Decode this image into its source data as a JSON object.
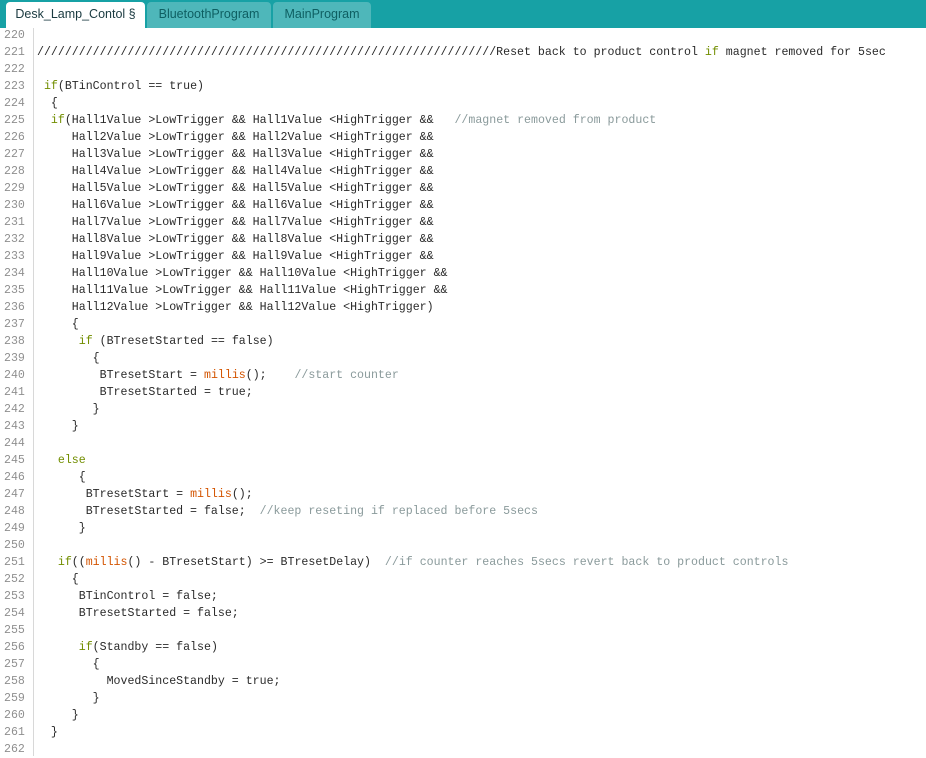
{
  "tabs": [
    {
      "label": "Desk_Lamp_Contol §",
      "active": true
    },
    {
      "label": "BluetoothProgram",
      "active": false
    },
    {
      "label": "MainProgram",
      "active": false
    }
  ],
  "colors": {
    "tabbar": "#17a1a5",
    "keyword": "#728e00",
    "function": "#d35400",
    "comment": "#8a9a9b"
  },
  "editor": {
    "lines": [
      {
        "n": "220",
        "text": ""
      },
      {
        "n": "221",
        "text": "//////////////////////////////////////////////////////////////////Reset back to product control if magnet removed for 5sec"
      },
      {
        "n": "222",
        "text": ""
      },
      {
        "n": "223",
        "text": " if(BTinControl == true)"
      },
      {
        "n": "224",
        "text": "  {"
      },
      {
        "n": "225",
        "text": "  if(Hall1Value >LowTrigger && Hall1Value <HighTrigger &&   //magnet removed from product"
      },
      {
        "n": "226",
        "text": "     Hall2Value >LowTrigger && Hall2Value <HighTrigger &&"
      },
      {
        "n": "227",
        "text": "     Hall3Value >LowTrigger && Hall3Value <HighTrigger &&"
      },
      {
        "n": "228",
        "text": "     Hall4Value >LowTrigger && Hall4Value <HighTrigger &&"
      },
      {
        "n": "229",
        "text": "     Hall5Value >LowTrigger && Hall5Value <HighTrigger &&"
      },
      {
        "n": "230",
        "text": "     Hall6Value >LowTrigger && Hall6Value <HighTrigger &&"
      },
      {
        "n": "231",
        "text": "     Hall7Value >LowTrigger && Hall7Value <HighTrigger &&"
      },
      {
        "n": "232",
        "text": "     Hall8Value >LowTrigger && Hall8Value <HighTrigger &&"
      },
      {
        "n": "233",
        "text": "     Hall9Value >LowTrigger && Hall9Value <HighTrigger &&"
      },
      {
        "n": "234",
        "text": "     Hall10Value >LowTrigger && Hall10Value <HighTrigger &&"
      },
      {
        "n": "235",
        "text": "     Hall11Value >LowTrigger && Hall11Value <HighTrigger &&"
      },
      {
        "n": "236",
        "text": "     Hall12Value >LowTrigger && Hall12Value <HighTrigger)"
      },
      {
        "n": "237",
        "text": "     {"
      },
      {
        "n": "238",
        "text": "      if (BTresetStarted == false)"
      },
      {
        "n": "239",
        "text": "        {"
      },
      {
        "n": "240",
        "text": "         BTresetStart = millis();    //start counter"
      },
      {
        "n": "241",
        "text": "         BTresetStarted = true;"
      },
      {
        "n": "242",
        "text": "        }"
      },
      {
        "n": "243",
        "text": "     }"
      },
      {
        "n": "244",
        "text": ""
      },
      {
        "n": "245",
        "text": "   else"
      },
      {
        "n": "246",
        "text": "      {"
      },
      {
        "n": "247",
        "text": "       BTresetStart = millis();"
      },
      {
        "n": "248",
        "text": "       BTresetStarted = false;  //keep reseting if replaced before 5secs"
      },
      {
        "n": "249",
        "text": "      }"
      },
      {
        "n": "250",
        "text": ""
      },
      {
        "n": "251",
        "text": "   if((millis() - BTresetStart) >= BTresetDelay)  //if counter reaches 5secs revert back to product controls"
      },
      {
        "n": "252",
        "text": "     {"
      },
      {
        "n": "253",
        "text": "      BTinControl = false;"
      },
      {
        "n": "254",
        "text": "      BTresetStarted = false;"
      },
      {
        "n": "255",
        "text": ""
      },
      {
        "n": "256",
        "text": "      if(Standby == false)"
      },
      {
        "n": "257",
        "text": "        {"
      },
      {
        "n": "258",
        "text": "          MovedSinceStandby = true;"
      },
      {
        "n": "259",
        "text": "        }"
      },
      {
        "n": "260",
        "text": "     }"
      },
      {
        "n": "261",
        "text": "  }"
      },
      {
        "n": "262",
        "text": ""
      }
    ]
  }
}
